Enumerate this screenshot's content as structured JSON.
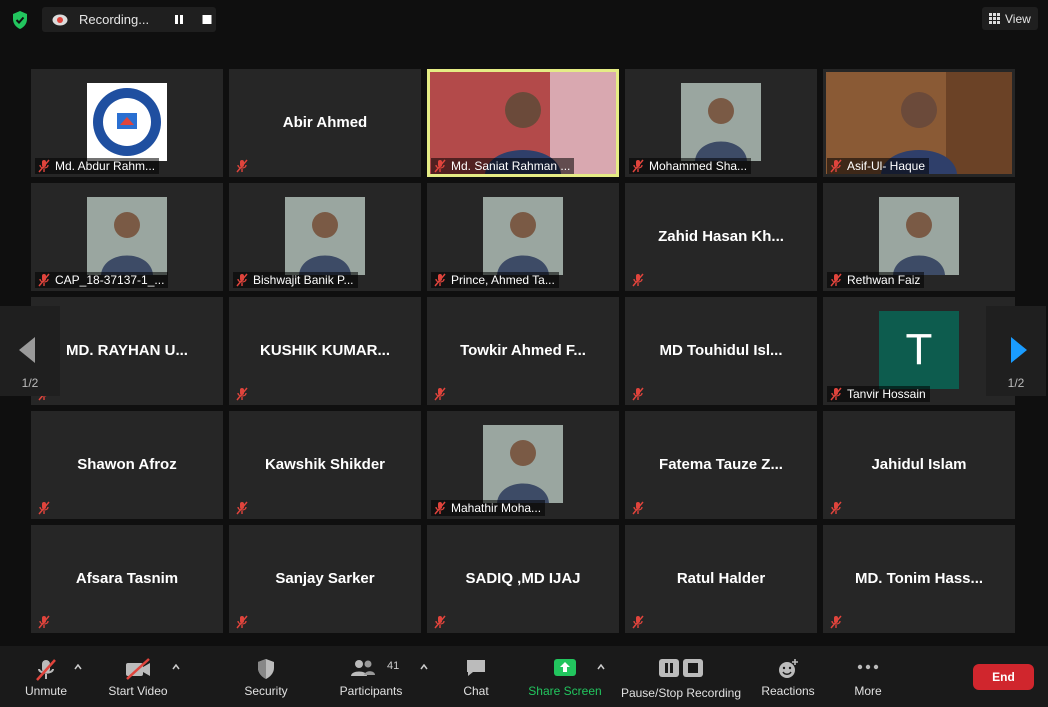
{
  "top": {
    "recording_label": "Recording...",
    "view_label": "View"
  },
  "pager": {
    "left_page": "1/2",
    "right_page": "1/2"
  },
  "tiles": [
    {
      "name": "Md. Abdur Rahm...",
      "kind": "logo"
    },
    {
      "name": "Abir Ahmed",
      "kind": "name"
    },
    {
      "name": "Md. Saniat Rahman ...",
      "kind": "video",
      "active": true
    },
    {
      "name": "Mohammed Sha...",
      "kind": "photo"
    },
    {
      "name": "Asif-Ul- Haque",
      "kind": "video"
    },
    {
      "name": "CAP_18-37137-1_...",
      "kind": "photo"
    },
    {
      "name": "Bishwajit Banik P...",
      "kind": "photo"
    },
    {
      "name": "Prince, Ahmed Ta...",
      "kind": "photo"
    },
    {
      "name": "Zahid Hasan Kh...",
      "kind": "name"
    },
    {
      "name": "Rethwan Faiz",
      "kind": "photo"
    },
    {
      "name": "MD. RAYHAN U...",
      "kind": "name"
    },
    {
      "name": "KUSHIK KUMAR...",
      "kind": "name"
    },
    {
      "name": "Towkir Ahmed F...",
      "kind": "name"
    },
    {
      "name": "MD Touhidul Isl...",
      "kind": "name"
    },
    {
      "name": "Tanvir Hossain",
      "kind": "avatar",
      "initial": "T"
    },
    {
      "name": "Shawon Afroz",
      "kind": "name"
    },
    {
      "name": "Kawshik Shikder",
      "kind": "name"
    },
    {
      "name": "Mahathir Moha...",
      "kind": "photo"
    },
    {
      "name": "Fatema Tauze Z...",
      "kind": "name"
    },
    {
      "name": "Jahidul Islam",
      "kind": "name"
    },
    {
      "name": "Afsara Tasnim",
      "kind": "name"
    },
    {
      "name": "Sanjay Sarker",
      "kind": "name"
    },
    {
      "name": "SADIQ ,MD IJAJ",
      "kind": "name"
    },
    {
      "name": "Ratul Halder",
      "kind": "name"
    },
    {
      "name": "MD. Tonim Hass...",
      "kind": "name"
    }
  ],
  "toolbar": {
    "unmute": "Unmute",
    "start_video": "Start Video",
    "security": "Security",
    "participants": "Participants",
    "participant_count": "41",
    "chat": "Chat",
    "share_screen": "Share Screen",
    "pause_stop": "Pause/Stop Recording",
    "reactions": "Reactions",
    "more": "More",
    "end": "End"
  },
  "colors": {
    "active_border": "#e5ec85",
    "share_green": "#22c55e",
    "end_red": "#d0262d",
    "mute_red": "#e0443c",
    "avatar_teal": "#0d5c4e",
    "nav_blue": "#1a9cff"
  }
}
